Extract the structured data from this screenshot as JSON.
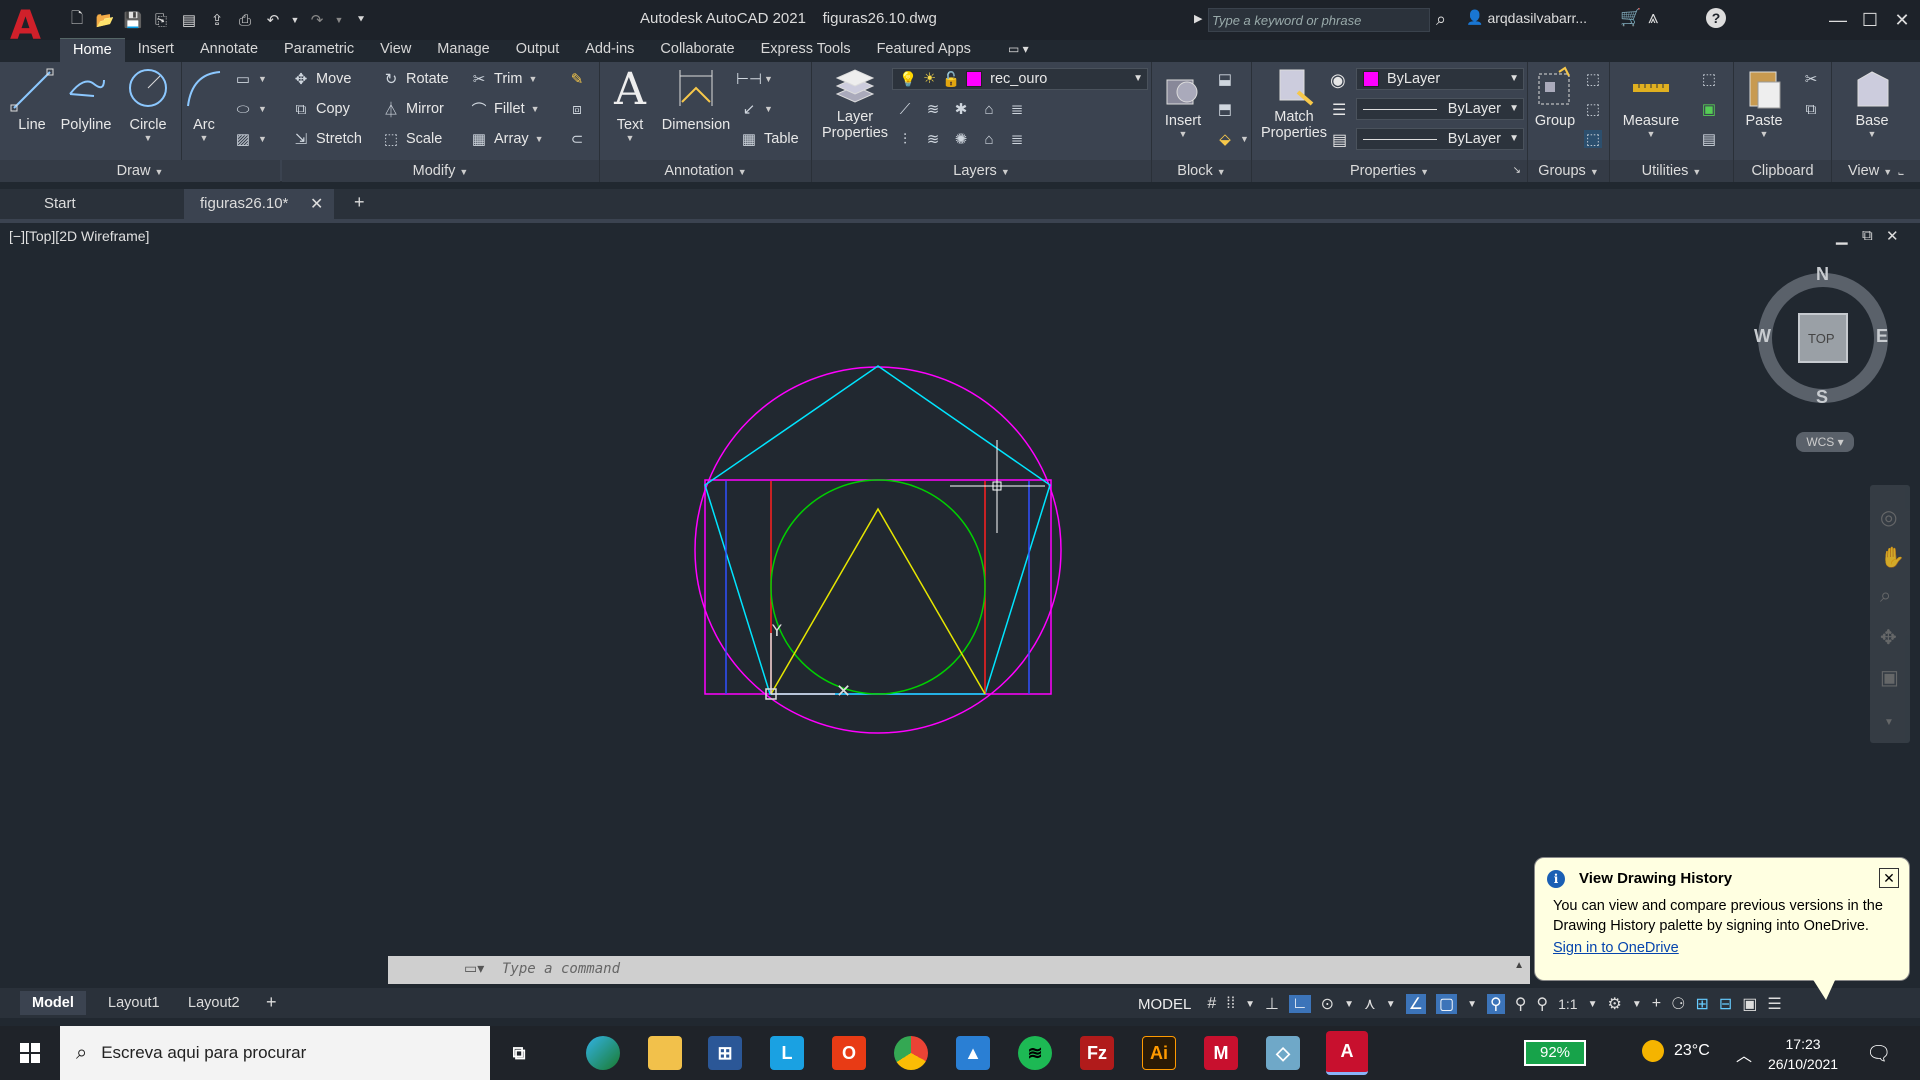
{
  "titlebar": {
    "app_name": "Autodesk AutoCAD 2021",
    "file_name": "figuras26.10.dwg",
    "search_placeholder": "Type a keyword or phrase",
    "user": "arqdasilvabarr..."
  },
  "ribbon_tabs": [
    "Home",
    "Insert",
    "Annotate",
    "Parametric",
    "View",
    "Manage",
    "Output",
    "Add-ins",
    "Collaborate",
    "Express Tools",
    "Featured Apps"
  ],
  "ribbon": {
    "draw": {
      "title": "Draw",
      "line": "Line",
      "polyline": "Polyline",
      "circle": "Circle",
      "arc": "Arc"
    },
    "modify": {
      "title": "Modify",
      "move": "Move",
      "rotate": "Rotate",
      "trim": "Trim",
      "copy": "Copy",
      "mirror": "Mirror",
      "fillet": "Fillet",
      "stretch": "Stretch",
      "scale": "Scale",
      "array": "Array"
    },
    "annotation": {
      "title": "Annotation",
      "text": "Text",
      "dimension": "Dimension",
      "table": "Table"
    },
    "layers": {
      "title": "Layers",
      "layer_properties_1": "Layer",
      "layer_properties_2": "Properties",
      "current_layer": "rec_ouro"
    },
    "block": {
      "title": "Block",
      "insert": "Insert"
    },
    "properties": {
      "title": "Properties",
      "match_1": "Match",
      "match_2": "Properties",
      "color": "ByLayer",
      "linetype": "ByLayer",
      "lineweight": "ByLayer"
    },
    "groups": {
      "title": "Groups",
      "group": "Group"
    },
    "utilities": {
      "title": "Utilities",
      "measure": "Measure"
    },
    "clipboard": {
      "title": "Clipboard",
      "paste": "Paste"
    },
    "view": {
      "title": "View",
      "base": "Base"
    }
  },
  "doc_tabs": {
    "start": "Start",
    "active": "figuras26.10*"
  },
  "viewport": {
    "label": "[−][Top][2D Wireframe]",
    "viewcube": {
      "n": "N",
      "s": "S",
      "e": "E",
      "w": "W",
      "face": "TOP",
      "wcs": "WCS"
    }
  },
  "command": {
    "placeholder": "Type a command"
  },
  "layout_tabs": [
    "Model",
    "Layout1",
    "Layout2"
  ],
  "status": {
    "model": "MODEL",
    "scale": "1:1"
  },
  "balloon": {
    "title": "View Drawing History",
    "body": "You can view and compare previous versions in the Drawing History palette by signing into OneDrive.",
    "link": "Sign in to OneDrive"
  },
  "taskbar": {
    "search": "Escreva aqui para procurar",
    "battery": "92%",
    "temperature": "23°C",
    "time": "17:23",
    "date": "26/10/2021"
  },
  "colors": {
    "magenta": "#ff00ff",
    "cyan": "#00e5ff",
    "green": "#00d000",
    "yellow": "#e6e600",
    "red": "#ff2020",
    "blue": "#3050ff"
  }
}
